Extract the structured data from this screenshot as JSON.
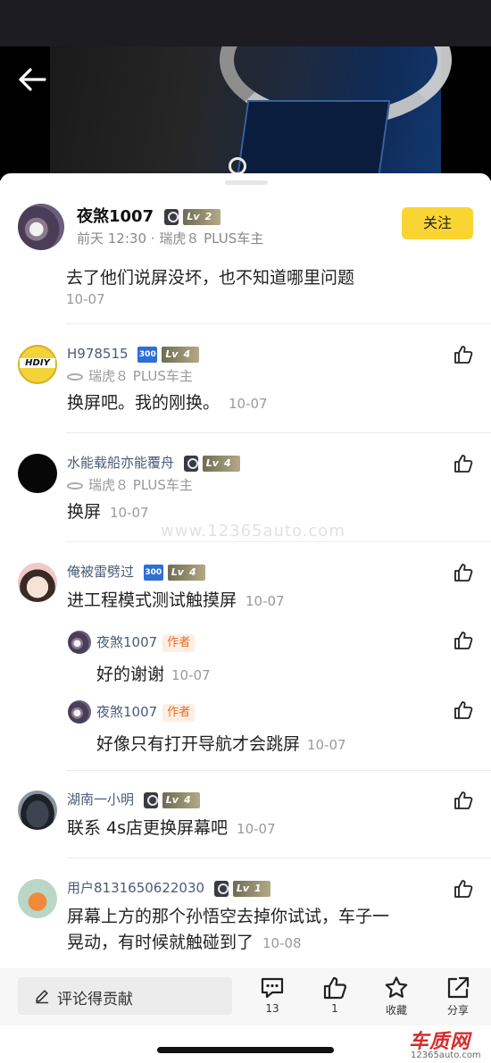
{
  "op": {
    "name": "夜煞1007",
    "level_text": "Lv",
    "level_num": "2",
    "time": "前天 12:30",
    "car": "瑞虎８ PLUS车主",
    "follow_label": "关注",
    "text": "去了他们说屏没坏，也不知道哪里问题",
    "date": "10-07"
  },
  "comments": [
    {
      "name": "H978515",
      "badge": "300",
      "level_num": "4",
      "car": "瑞虎８ PLUS车主",
      "text": "换屏吧。我的刚换。",
      "date": "10-07"
    },
    {
      "name": "水能载船亦能覆舟",
      "level_num": "4",
      "car": "瑞虎８ PLUS车主",
      "text": "换屏",
      "date": "10-07"
    },
    {
      "name": "俺被雷劈过",
      "badge": "300",
      "level_num": "4",
      "text": "进工程模式测试触摸屏",
      "date": "10-07",
      "replies": [
        {
          "name": "夜煞1007",
          "tag": "作者",
          "text": "好的谢谢",
          "date": "10-07"
        },
        {
          "name": "夜煞1007",
          "tag": "作者",
          "text": "好像只有打开导航才会跳屏",
          "date": "10-07"
        }
      ]
    },
    {
      "name": "湖南一小明",
      "level_num": "4",
      "text": "联系 4s店更换屏幕吧",
      "date": "10-07"
    },
    {
      "name": "用户8131650622030",
      "level_num": "1",
      "text_line1": "屏幕上方的那个孙悟空去掉你试试，车子一",
      "text_line2": "晃动，有时候就触碰到了",
      "date": "10-08"
    }
  ],
  "watermark": "www.12365auto.com",
  "hdiy_label": "HDIY",
  "bottom": {
    "input_placeholder": "评论得贡献",
    "comments_count": "13",
    "likes_count": "1",
    "collect_label": "收藏",
    "share_label": "分享"
  },
  "logo": {
    "big": "车质网",
    "small": "12365auto.com"
  },
  "colors": {
    "follow_bg": "#f9d534",
    "author_tag": "#e06f2a",
    "name_color": "#4a5b76"
  }
}
